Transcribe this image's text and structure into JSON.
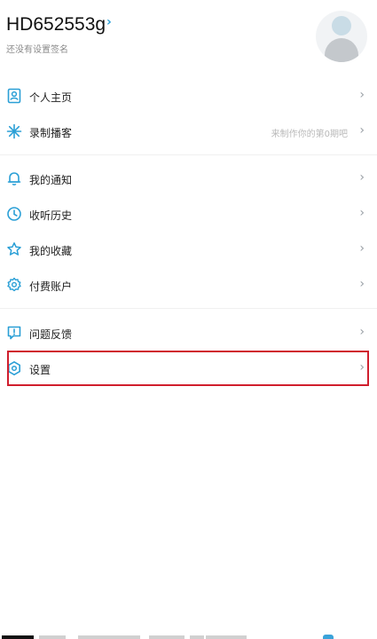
{
  "profile": {
    "username": "HD652553g",
    "chevron": "›",
    "signature": "还没有设置签名",
    "avatar_icon": "default-avatar"
  },
  "colors": {
    "accent": "#2a9fd6",
    "highlight_border": "#d01e2d",
    "divider": "#f0f0f0"
  },
  "menu": {
    "group1": [
      {
        "label": "个人主页",
        "icon": "profile-page-icon",
        "hint": ""
      },
      {
        "label": "录制播客",
        "icon": "record-podcast-icon",
        "hint": "来制作你的第0期吧"
      }
    ],
    "group2": [
      {
        "label": "我的通知",
        "icon": "bell-icon",
        "hint": ""
      },
      {
        "label": "收听历史",
        "icon": "clock-icon",
        "hint": ""
      },
      {
        "label": "我的收藏",
        "icon": "star-icon",
        "hint": ""
      },
      {
        "label": "付费账户",
        "icon": "gear-account-icon",
        "hint": ""
      }
    ],
    "group3": [
      {
        "label": "问题反馈",
        "icon": "feedback-icon",
        "hint": ""
      },
      {
        "label": "设置",
        "icon": "settings-icon",
        "hint": ""
      }
    ]
  }
}
